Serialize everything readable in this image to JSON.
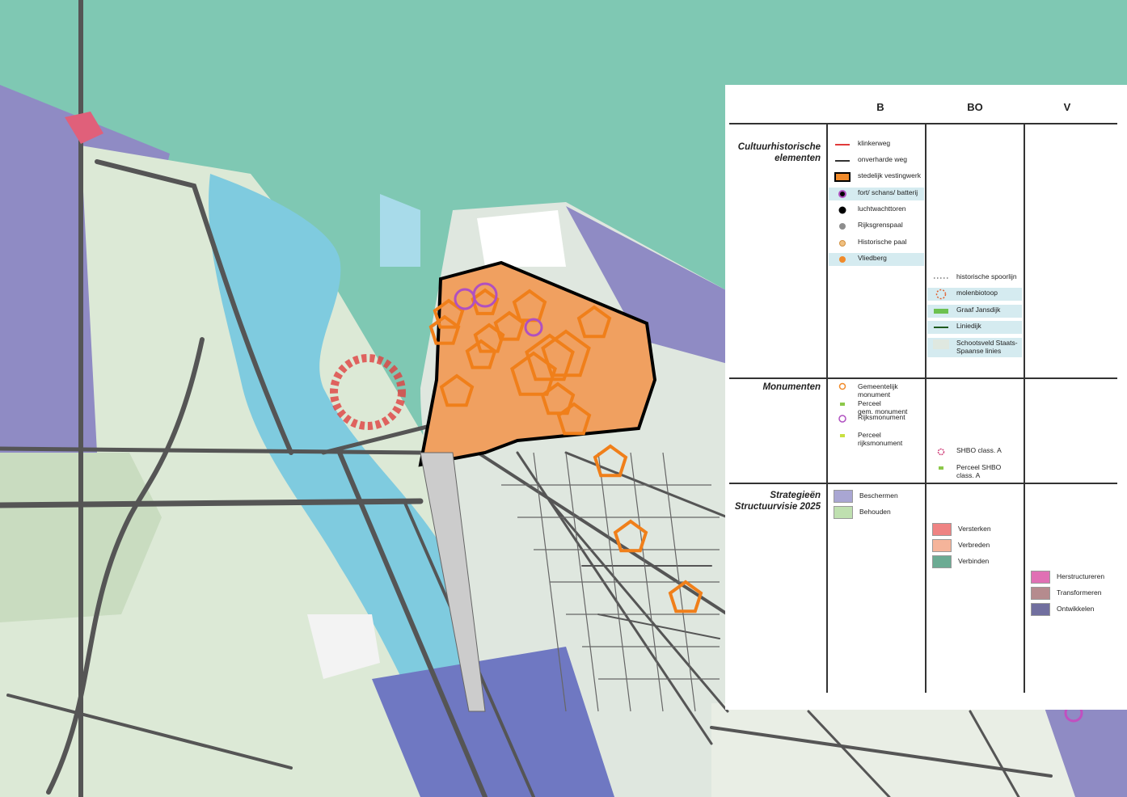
{
  "legend": {
    "columns": [
      "B",
      "BO",
      "V"
    ],
    "sections": {
      "cultuur": "Cultuurhistorische elementen",
      "monumenten": "Monumenten",
      "strategie": "Strategieën Structuurvisie 2025"
    },
    "b_items": [
      {
        "label": "klinkerweg",
        "symbol": "red-line-icon"
      },
      {
        "label": "onverharde weg",
        "symbol": "dark-line-icon"
      },
      {
        "label": "stedelijk vestingwerk",
        "symbol": "orange-box-icon"
      },
      {
        "label": "fort/ schans/ batterij",
        "symbol": "purple-dot-icon"
      },
      {
        "label": "luchtwachttoren",
        "symbol": "black-dot-icon"
      },
      {
        "label": "Rijksgrenspaal",
        "symbol": "grey-dot-icon"
      },
      {
        "label": "Historische paal",
        "symbol": "tan-dot-icon"
      },
      {
        "label": "Vliedberg",
        "symbol": "orange-dot-icon"
      }
    ],
    "bo_items": [
      {
        "label": "historische spoorlijn",
        "symbol": "dotted-line-icon"
      },
      {
        "label": "molenbiotoop",
        "symbol": "dashed-circle-icon"
      },
      {
        "label": "Graaf Jansdijk",
        "symbol": "green-bar-icon"
      },
      {
        "label": "Liniedijk",
        "symbol": "dark-green-line-icon"
      },
      {
        "label": "Schootsveld Staats-\nSpaanse linies",
        "symbol": "pale-swatch-icon"
      }
    ],
    "monument_b": [
      {
        "label": "Gemeentelijk\nmonument",
        "symbol": "orange-ring-icon"
      },
      {
        "label": "Perceel\ngem. monument",
        "symbol": "green-square-icon"
      },
      {
        "label": "Rijksmonument",
        "symbol": "purple-ring-icon"
      },
      {
        "label": "Perceel\nrijksmonument",
        "symbol": "lime-square-icon"
      }
    ],
    "monument_bo": [
      {
        "label": "SHBO class. A",
        "symbol": "pink-ring-icon"
      },
      {
        "label": "Perceel SHBO\nclass. A",
        "symbol": "green-square-icon"
      }
    ],
    "strat_b": [
      {
        "label": "Beschermen",
        "color": "#a9a6d3"
      },
      {
        "label": "Behouden",
        "color": "#bfe0b0"
      }
    ],
    "strat_bo": [
      {
        "label": "Versterken",
        "color": "#ef8383"
      },
      {
        "label": "Verbreden",
        "color": "#f5b49a"
      },
      {
        "label": "Verbinden",
        "color": "#6bab93"
      }
    ],
    "strat_v": [
      {
        "label": "Herstructureren",
        "color": "#e070b4"
      },
      {
        "label": "Transformeren",
        "color": "#b58b8e"
      },
      {
        "label": "Ontwikkelen",
        "color": "#716f9f"
      }
    ]
  },
  "map": {
    "sea_color": "#7fc8b3",
    "water_color": "#7fcbdf",
    "monument_color": "#f07f1a"
  }
}
